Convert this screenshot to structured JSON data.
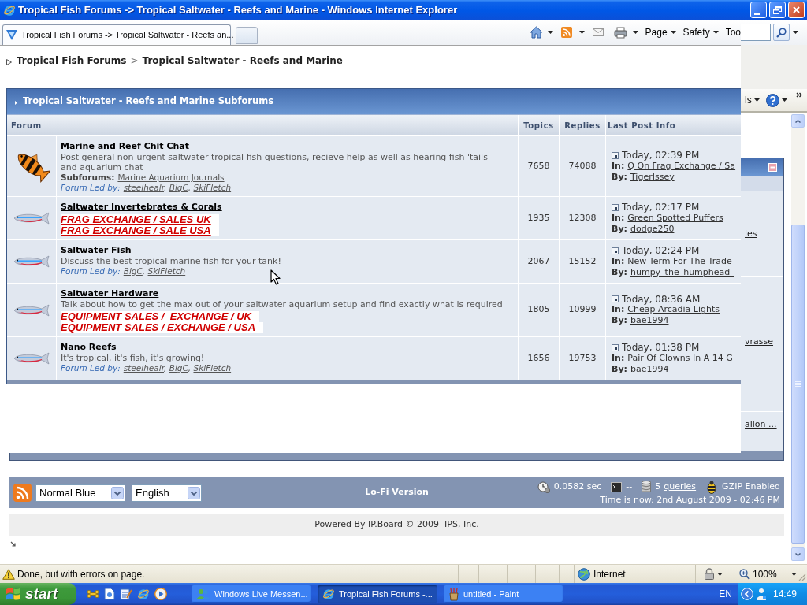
{
  "window": {
    "title": "Tropical Fish Forums -> Tropical Saltwater - Reefs and Marine - Windows Internet Explorer"
  },
  "tabs": [
    {
      "label": "Tropical Fish Forums -> Tropical Saltwater - Reefs an...",
      "selected": true
    }
  ],
  "command_bar": {
    "menus": [
      {
        "label": "Page",
        "dropdown": true
      },
      {
        "label": "Safety",
        "dropdown": true
      },
      {
        "label": "Too",
        "dropdown": false
      }
    ]
  },
  "command_bar_behind": {
    "menu": "ls"
  },
  "breadcrumb": {
    "items": [
      "Tropical Fish Forums",
      "Tropical Saltwater - Reefs and Marine"
    ],
    "separator": ">"
  },
  "category": {
    "title": "Tropical Saltwater - Reefs and Marine Subforums",
    "columns": [
      "Forum",
      "Topics",
      "Replies",
      "Last Post Info"
    ],
    "forums": [
      {
        "unread": true,
        "title": "Marine and Reef Chit Chat",
        "description": "Post general non-urgent saltwater tropical fish questions, recieve help as well as hearing fish 'tails' and aquarium chat",
        "subforums": {
          "label": "Subforums:",
          "links": [
            "Marine Aquarium Journals"
          ]
        },
        "moderators": {
          "label": "Forum Led by:",
          "names": [
            "steelhealr",
            "BigC",
            "SkiFletch"
          ],
          "separator": ", "
        },
        "topics": "7658",
        "replies": "74088",
        "last_post": {
          "date": "Today, 02:39 PM",
          "in_label": "In:",
          "topic": "Q On Frag Exchange / Sa",
          "by_label": "By:",
          "author": "TigerIssey"
        }
      },
      {
        "unread": false,
        "title": "Saltwater Invertebrates & Corals",
        "promo_links": [
          "FRAG EXCHANGE / SALES UK",
          "FRAG EXCHANGE / SALE USA"
        ],
        "topics": "1935",
        "replies": "12308",
        "last_post": {
          "date": "Today, 02:17 PM",
          "in_label": "In:",
          "topic": "Green Spotted Puffers",
          "by_label": "By:",
          "author": "dodge250"
        }
      },
      {
        "unread": false,
        "title": "Saltwater Fish",
        "description": "Discuss the best tropical marine fish for your tank!",
        "moderators": {
          "label": "Forum Led by:",
          "names": [
            "BigC",
            "SkiFletch"
          ],
          "separator": ", "
        },
        "topics": "2067",
        "replies": "15152",
        "last_post": {
          "date": "Today, 02:24 PM",
          "in_label": "In:",
          "topic": "New Term For The Trade",
          "by_label": "By:",
          "author": "humpy_the_humphead_"
        }
      },
      {
        "unread": false,
        "title": "Saltwater Hardware",
        "description": "Talk about how to get the max out of your saltwater aquarium setup and find exactly what is required",
        "promo_links": [
          "EQUIPMENT SALES /  EXCHANGE / UK",
          "EQUIPMENT SALES / EXCHANGE / USA"
        ],
        "topics": "1805",
        "replies": "10999",
        "last_post": {
          "date": "Today, 08:36 AM",
          "in_label": "In:",
          "topic": "Cheap Arcadia Lights",
          "by_label": "By:",
          "author": "bae1994"
        }
      },
      {
        "unread": false,
        "title": "Nano Reefs",
        "description": "It's tropical, it's fish, it's growing!",
        "moderators": {
          "label": "Forum Led by:",
          "names": [
            "steelhealr",
            "BigC",
            "SkiFletch"
          ],
          "separator": ", "
        },
        "topics": "1656",
        "replies": "19753",
        "last_post": {
          "date": "Today, 01:38 PM",
          "in_label": "In:",
          "topic": "Pair Of Clowns In A 14 G",
          "by_label": "By:",
          "author": "bae1994"
        }
      }
    ]
  },
  "side_panel": {
    "links": [
      "les",
      "vrasse",
      "allon ..."
    ]
  },
  "footer": {
    "skin": "Normal Blue",
    "language": "English",
    "lofi_link": "Lo-Fi Version",
    "stats": [
      {
        "kind": "timer",
        "text": "0.0582 sec"
      },
      {
        "kind": "load",
        "text": "--"
      },
      {
        "kind": "queries",
        "count": "5",
        "link": "queries"
      },
      {
        "kind": "gzip",
        "text": "GZIP Enabled"
      }
    ],
    "time": "Time is now: 2nd August 2009 - 02:46 PM"
  },
  "copyright": "Powered By IP.Board © 2009  IPS, Inc.",
  "status_bar": {
    "text": "Done, but with errors on page.",
    "zone": "Internet",
    "zoom": "100%"
  },
  "taskbar": {
    "start": "start",
    "tasks": [
      {
        "kind": "messenger",
        "label": "Windows Live Messen...",
        "selected": false
      },
      {
        "kind": "browser",
        "label": "Tropical Fish Forums -...",
        "selected": true
      },
      {
        "kind": "paint",
        "label": "untitled - Paint",
        "selected": false
      }
    ],
    "language": "EN",
    "clock": "14:49"
  }
}
